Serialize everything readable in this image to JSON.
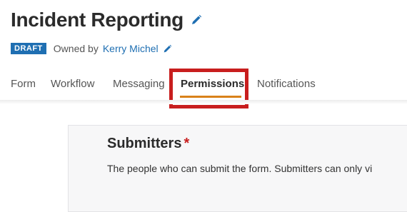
{
  "header": {
    "title": "Incident Reporting",
    "status_badge": "DRAFT",
    "owned_by_label": "Owned by",
    "owner_name": "Kerry Michel"
  },
  "tabs": [
    {
      "label": "Form"
    },
    {
      "label": "Workflow"
    },
    {
      "label": "Messaging"
    },
    {
      "label": "Permissions",
      "active": true
    },
    {
      "label": "Notifications"
    }
  ],
  "section": {
    "title": "Submitters",
    "required_marker": "*",
    "description": "The people who can submit the form. Submitters can only vi"
  },
  "colors": {
    "accent": "#1f6fb2",
    "active_tab_underline": "#d9821a",
    "highlight": "#c81e1e"
  },
  "icons": {
    "title_edit": "pencil-icon",
    "owner_edit": "pencil-icon"
  }
}
